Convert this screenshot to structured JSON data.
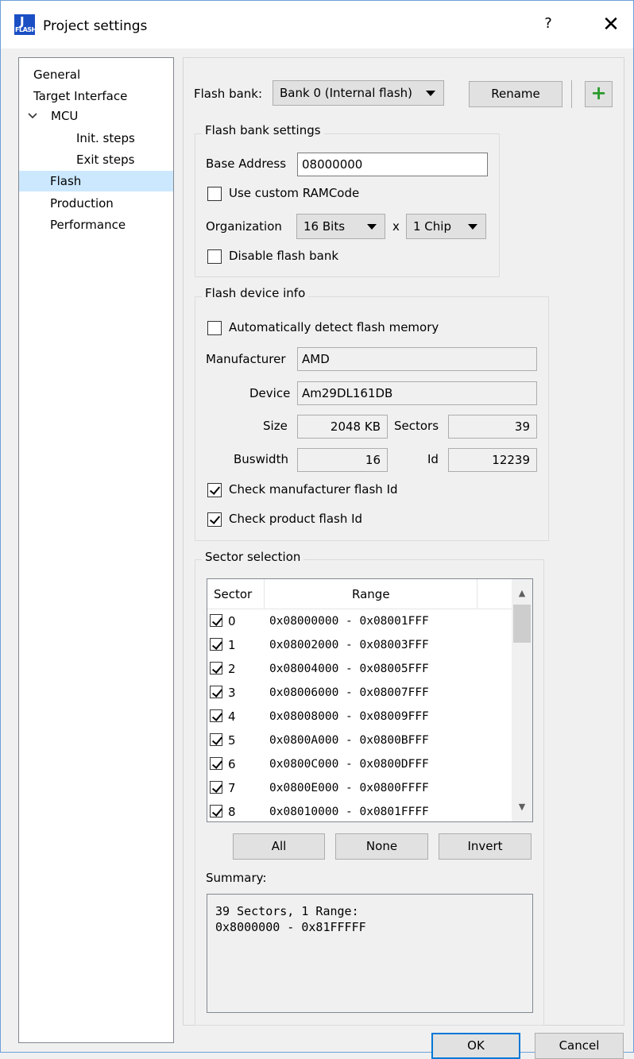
{
  "window": {
    "title": "Project settings",
    "help_label": "?",
    "close_label": "✕",
    "icon": "jflash-app-icon",
    "icon_text_top": "J",
    "icon_text_bottom": "FLASH"
  },
  "tree": {
    "items": [
      {
        "label": "General"
      },
      {
        "label": "Target Interface"
      },
      {
        "label": "MCU"
      },
      {
        "label": "Init. steps"
      },
      {
        "label": "Exit steps"
      },
      {
        "label": "Flash"
      },
      {
        "label": "Production"
      },
      {
        "label": "Performance"
      }
    ],
    "selected": "Flash"
  },
  "flash_bank": {
    "label": "Flash bank:",
    "selected": "Bank 0 (Internal flash)",
    "rename_label": "Rename",
    "add_label": "+"
  },
  "bank_settings": {
    "title": "Flash bank settings",
    "base_address_label": "Base Address",
    "base_address_value": "08000000",
    "custom_ramcode_label": "Use custom RAMCode",
    "custom_ramcode_checked": false,
    "organization_label": "Organization",
    "bits_value": "16 Bits",
    "x_label": "x",
    "chips_value": "1 Chip",
    "disable_label": "Disable flash bank",
    "disable_checked": false
  },
  "device_info": {
    "title": "Flash device info",
    "auto_detect_label": "Automatically detect flash memory",
    "auto_detect_checked": false,
    "manufacturer_label": "Manufacturer",
    "manufacturer_value": "AMD",
    "device_label": "Device",
    "device_value": "Am29DL161DB",
    "size_label": "Size",
    "size_value": "2048 KB",
    "sectors_label": "Sectors",
    "sectors_value": "39",
    "buswidth_label": "Buswidth",
    "buswidth_value": "16",
    "id_label": "Id",
    "id_value": "12239",
    "check_manufacturer_label": "Check manufacturer flash Id",
    "check_manufacturer_checked": true,
    "check_product_label": "Check product flash Id",
    "check_product_checked": true
  },
  "sector_selection": {
    "title": "Sector selection",
    "columns": [
      "Sector",
      "Range"
    ],
    "rows": [
      {
        "sector": "0",
        "range": "0x08000000 - 0x08001FFF",
        "checked": true
      },
      {
        "sector": "1",
        "range": "0x08002000 - 0x08003FFF",
        "checked": true
      },
      {
        "sector": "2",
        "range": "0x08004000 - 0x08005FFF",
        "checked": true
      },
      {
        "sector": "3",
        "range": "0x08006000 - 0x08007FFF",
        "checked": true
      },
      {
        "sector": "4",
        "range": "0x08008000 - 0x08009FFF",
        "checked": true
      },
      {
        "sector": "5",
        "range": "0x0800A000 - 0x0800BFFF",
        "checked": true
      },
      {
        "sector": "6",
        "range": "0x0800C000 - 0x0800DFFF",
        "checked": true
      },
      {
        "sector": "7",
        "range": "0x0800E000 - 0x0800FFFF",
        "checked": true
      },
      {
        "sector": "8",
        "range": "0x08010000 - 0x0801FFFF",
        "checked": true
      }
    ],
    "all_label": "All",
    "none_label": "None",
    "invert_label": "Invert",
    "summary_label": "Summary:",
    "summary_line1": "39 Sectors, 1 Range:",
    "summary_line2": "0x8000000 - 0x81FFFFF"
  },
  "footer": {
    "ok_label": "OK",
    "cancel_label": "Cancel"
  }
}
